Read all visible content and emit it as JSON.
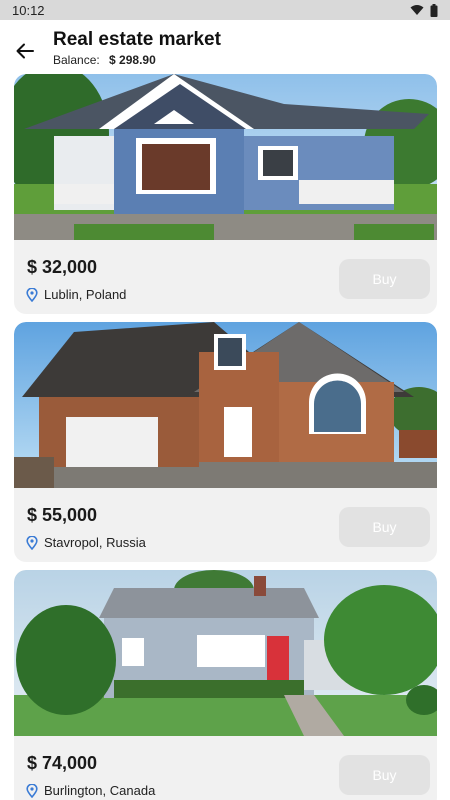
{
  "status": {
    "time": "10:12"
  },
  "header": {
    "title": "Real estate market",
    "balance_label": "Balance:",
    "balance_value": "$ 298.90"
  },
  "listings": [
    {
      "price": "$ 32,000",
      "location": "Lublin, Poland",
      "buy_label": "Buy"
    },
    {
      "price": "$ 55,000",
      "location": "Stavropol, Russia",
      "buy_label": "Buy"
    },
    {
      "price": "$ 74,000",
      "location": "Burlington, Canada",
      "buy_label": "Buy"
    }
  ],
  "colors": {
    "pin_icon": "#3a7bd5",
    "buy_button_disabled": "#e2e2e2",
    "card_bg": "#f1f1f1"
  }
}
